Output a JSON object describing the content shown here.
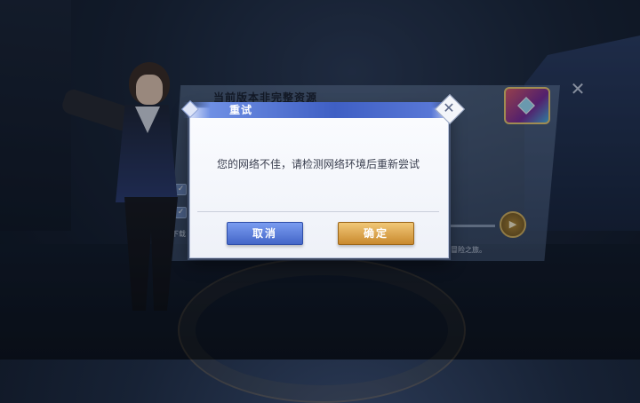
{
  "background": {
    "panel_title": "当前版本非完整资源",
    "panel_hint": "下载",
    "panel_footer": "冒险之旅。",
    "checkbox_mark": "✓",
    "close_glyph": "✕",
    "play_glyph": "▶"
  },
  "dialog": {
    "title": "重试",
    "message": "您的网络不佳，请检测网络环境后重新尝试",
    "cancel_label": "取消",
    "confirm_label": "确定",
    "close_glyph": "✕"
  },
  "colors": {
    "dialog_title_bar": "#3f5fc4",
    "cancel_button": "#4466c8",
    "confirm_button": "#c9892e",
    "message_text": "#3b4050"
  }
}
